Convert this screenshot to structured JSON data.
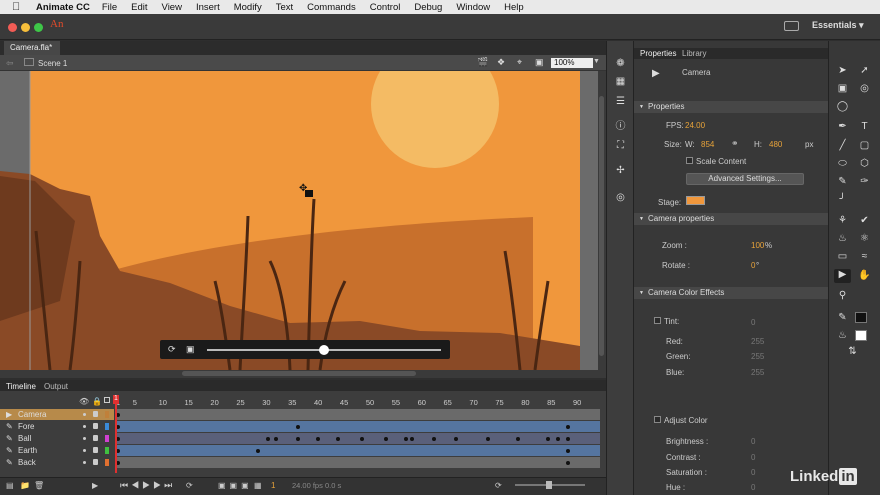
{
  "menubar": {
    "app_name": "Animate CC",
    "items": [
      "File",
      "Edit",
      "View",
      "Insert",
      "Modify",
      "Text",
      "Commands",
      "Control",
      "Debug",
      "Window",
      "Help"
    ]
  },
  "appbar": {
    "logo": "An",
    "workspace": "Essentials"
  },
  "document": {
    "tab_title": "Camera.fla*",
    "scene": "Scene 1",
    "zoom": "100%"
  },
  "properties": {
    "tabs": [
      "Properties",
      "Library"
    ],
    "object_type": "Camera",
    "section_properties": "Properties",
    "fps_label": "FPS:",
    "fps_value": "24.00",
    "size_label": "Size:",
    "w_label": "W:",
    "w_value": "854",
    "h_label": "H:",
    "h_value": "480",
    "unit": "px",
    "scale_content": "Scale Content",
    "advanced_settings": "Advanced Settings...",
    "stage_label": "Stage:",
    "stage_color": "#f0973c",
    "section_camera": "Camera properties",
    "zoom_label": "Zoom :",
    "zoom_value": "100",
    "zoom_unit": "%",
    "rotate_label": "Rotate :",
    "rotate_value": "0",
    "rotate_unit": "°",
    "section_color": "Camera Color Effects",
    "tint_label": "Tint:",
    "tint_value": "0",
    "red_label": "Red:",
    "red_value": "255",
    "green_label": "Green:",
    "green_value": "255",
    "blue_label": "Blue:",
    "blue_value": "255",
    "adjust_color": "Adjust Color",
    "brightness_label": "Brightness :",
    "brightness_value": "0",
    "contrast_label": "Contrast :",
    "contrast_value": "0",
    "saturation_label": "Saturation :",
    "saturation_value": "0",
    "hue_label": "Hue :",
    "hue_value": "0"
  },
  "timeline": {
    "tabs": [
      "Timeline",
      "Output"
    ],
    "ruler": [
      "1",
      "5",
      "10",
      "15",
      "20",
      "25",
      "30",
      "35",
      "40",
      "45",
      "50",
      "55",
      "60",
      "65",
      "70",
      "75",
      "80",
      "85",
      "90"
    ],
    "layers": [
      {
        "name": "Camera",
        "color": "#c0803a"
      },
      {
        "name": "Fore",
        "color": "#3a8ad8"
      },
      {
        "name": "Ball",
        "color": "#d040d0"
      },
      {
        "name": "Earth",
        "color": "#40c040"
      },
      {
        "name": "Back",
        "color": "#e07030"
      }
    ],
    "current_frame": "1",
    "fps": "24.00 fps",
    "time": "0.0 s"
  },
  "watermark": "Linked"
}
